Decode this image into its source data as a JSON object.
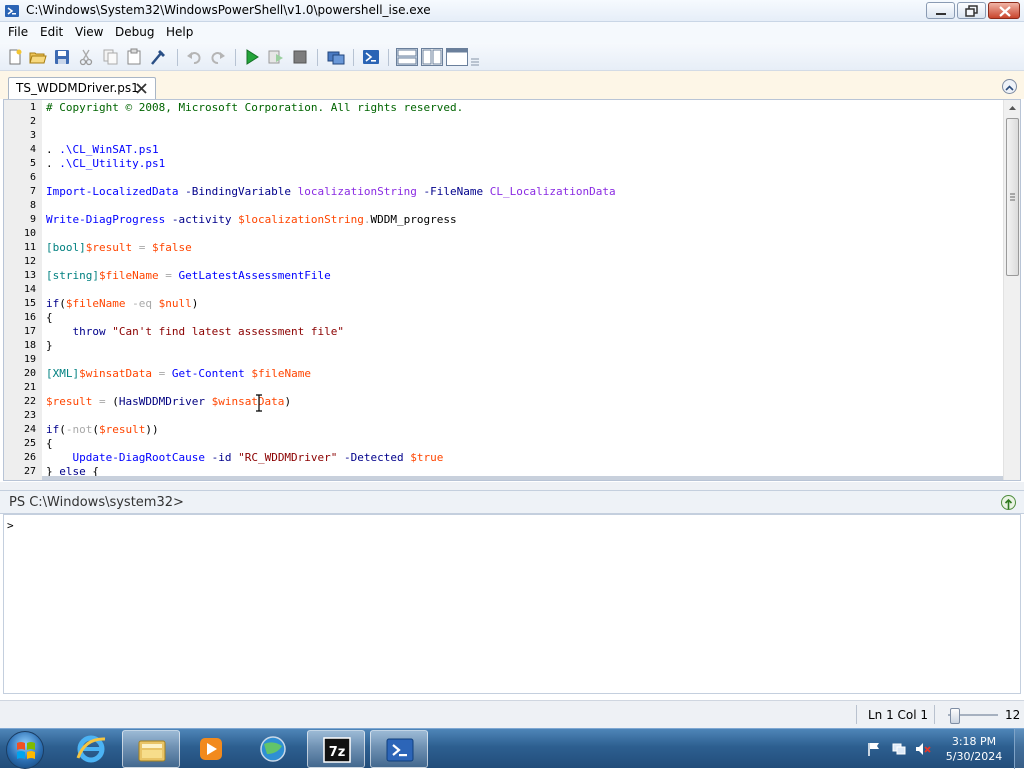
{
  "window": {
    "title": "C:\\Windows\\System32\\WindowsPowerShell\\v1.0\\powershell_ise.exe"
  },
  "menu": [
    "File",
    "Edit",
    "View",
    "Debug",
    "Help"
  ],
  "toolbar": {
    "buttons": [
      "new-script",
      "open",
      "save",
      "cut",
      "copy",
      "paste",
      "clear-output",
      "undo",
      "redo",
      "run-script",
      "run-selection",
      "stop",
      "new-remote-tab",
      "start-powershell",
      "layout-script-top",
      "layout-script-right",
      "layout-script-maximized"
    ]
  },
  "tab": {
    "label": "TS_WDDMDriver.ps1"
  },
  "script": {
    "line_numbers": [
      "1",
      "2",
      "3",
      "4",
      "5",
      "6",
      "7",
      "8",
      "9",
      "10",
      "11",
      "12",
      "13",
      "14",
      "15",
      "16",
      "17",
      "18",
      "19",
      "20",
      "21",
      "22",
      "23",
      "24",
      "25",
      "26",
      "27"
    ],
    "l1": "# Copyright © 2008, Microsoft Corporation. All rights reserved.",
    "l4a": ". ",
    "l4b": ".\\CL_WinSAT.ps1",
    "l5a": ". ",
    "l5b": ".\\CL_Utility.ps1",
    "l7a": "Import-LocalizedData",
    "l7b": " -BindingVariable ",
    "l7c": "localizationString",
    "l7d": " -FileName ",
    "l7e": "CL_LocalizationData",
    "l9a": "Write-DiagProgress",
    "l9b": " -activity ",
    "l9c": "$localizationString",
    "l9d": ".",
    "l9e": "WDDM_progress",
    "l11a": "[bool]",
    "l11b": "$result",
    "l11c": " = ",
    "l11d": "$false",
    "l13a": "[string]",
    "l13b": "$fileName",
    "l13c": " = ",
    "l13d": "GetLatestAssessmentFile",
    "l15a": "if",
    "l15b": "(",
    "l15c": "$fileName",
    "l15d": " -eq ",
    "l15e": "$null",
    "l15f": ")",
    "l16": "{",
    "l17a": "    throw",
    "l17b": " \"Can't find latest assessment file\"",
    "l18": "}",
    "l20a": "[XML]",
    "l20b": "$winsatData",
    "l20c": " = ",
    "l20d": "Get-Content",
    "l20e": " $fileName",
    "l22a": "$result",
    "l22b": " = ",
    "l22c": "(",
    "l22d": "HasWDDMDriver",
    "l22e": " $winsatData",
    "l22f": ")",
    "l24a": "if",
    "l24b": "(",
    "l24c": "-not",
    "l24d": "(",
    "l24e": "$result",
    "l24f": "))",
    "l25": "{",
    "l26a": "    Update-DiagRootCause",
    "l26b": " -id ",
    "l26c": "\"RC_WDDMDriver\"",
    "l26d": " -Detected ",
    "l26e": "$true",
    "l27a": "} ",
    "l27b": "else",
    "l27c": " {"
  },
  "output": {
    "path_label": "PS C:\\Windows\\system32>",
    "prompt": ">"
  },
  "status": {
    "position": "Ln 1  Col 1",
    "zoom_value": "12"
  },
  "taskbar": {
    "pinned": [
      "internet-explorer",
      "windows-explorer",
      "media-player",
      "network-globe",
      "7zip",
      "powershell-ise"
    ],
    "time": "3:18 PM",
    "date": "5/30/2024"
  },
  "colors": {
    "comment": "#006400",
    "cmdlet": "#0000ff",
    "variable": "#ff4500",
    "string": "#8b0000",
    "type": "#008080",
    "operator": "#a9a9a9",
    "argument": "#8a2be2"
  }
}
